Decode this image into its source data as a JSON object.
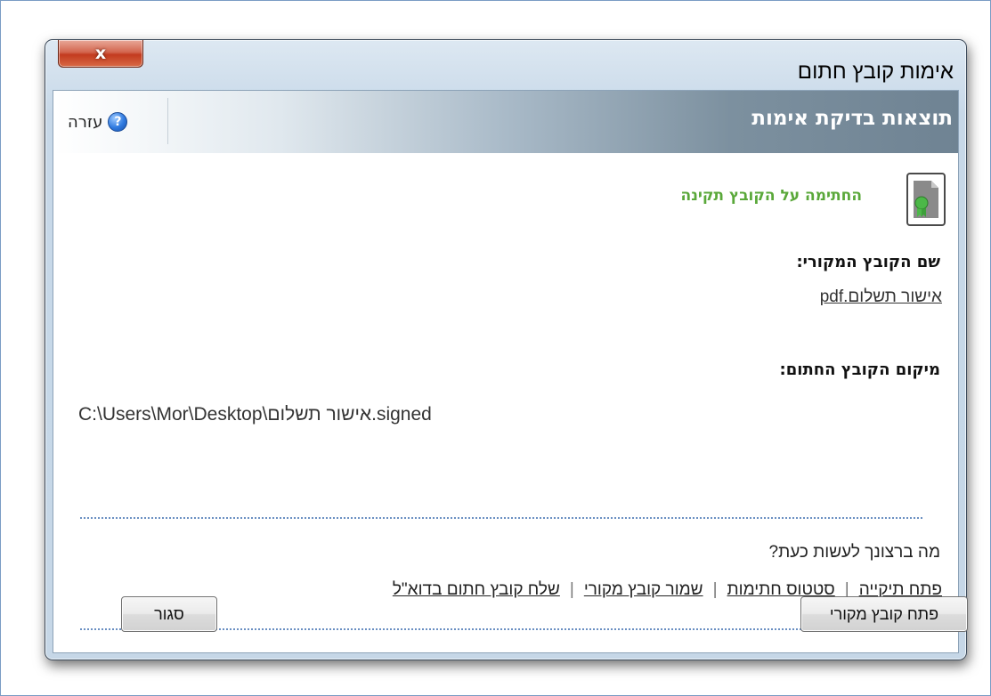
{
  "window": {
    "title": "אימות קובץ חתום",
    "close_symbol": "x"
  },
  "header": {
    "title": "תוצאות בדיקת אימות",
    "help_label": "עזרה",
    "help_icon_glyph": "?"
  },
  "result": {
    "status": "החתימה על הקובץ תקינה",
    "status_color": "#5aa83a",
    "icon": "certificate-file-icon"
  },
  "original_file": {
    "label": "שם הקובץ המקורי:",
    "name": "אישור תשלום.pdf"
  },
  "signed_file": {
    "label": "מיקום הקובץ החתום:",
    "path": "C:\\Users\\Mor\\Desktop\\אישור תשלום.signed"
  },
  "next_actions": {
    "question": "מה ברצונך לעשות כעת?",
    "links": [
      "פתח תיקייה",
      "סטטוס חתימות",
      "שמור קובץ מקורי",
      "שלח קובץ חתום בדוא\"ל"
    ],
    "separator": "|"
  },
  "buttons": {
    "open_original": "פתח קובץ מקורי",
    "close": "סגור"
  }
}
